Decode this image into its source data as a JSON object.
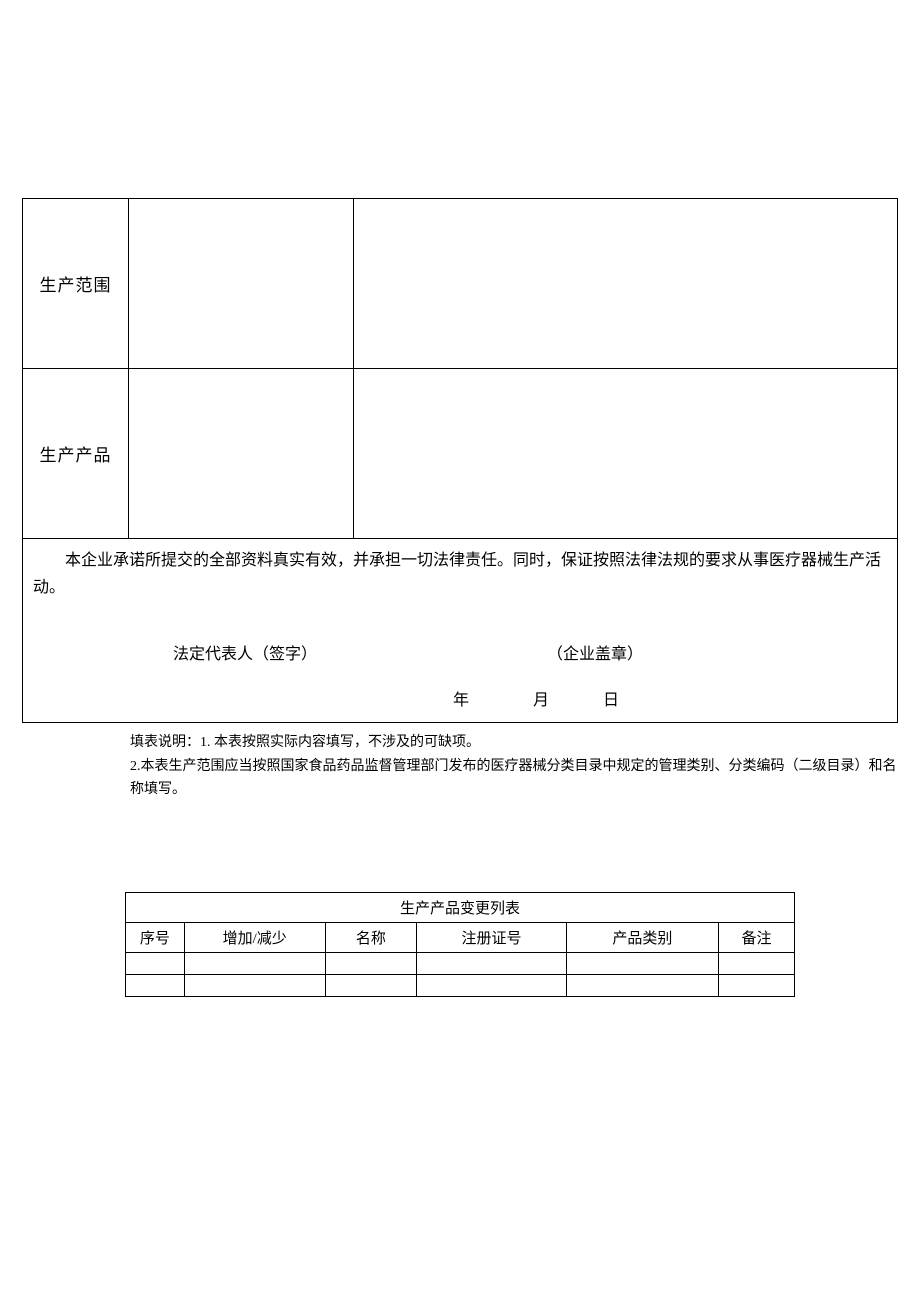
{
  "main": {
    "row1_label": "生产范围",
    "row2_label": "生产产品",
    "declaration": "本企业承诺所提交的全部资料真实有效，并承担一切法律责任。同时，保证按照法律法规的要求从事医疗器械生产活动。",
    "sig_legal_rep": "法定代表人（签字）",
    "sig_seal": "（企业盖章）",
    "date_year": "年",
    "date_month": "月",
    "date_day": "日"
  },
  "notes": {
    "note1": "填表说明：1. 本表按照实际内容填写，不涉及的可缺项。",
    "note2": "2.本表生产范围应当按照国家食品药品监督管理部门发布的医疗器械分类目录中规定的管理类别、分类编码（二级目录）和名称填写。"
  },
  "change_table": {
    "title": "生产产品变更列表",
    "headers": {
      "seq": "序号",
      "inc_dec": "增加/减少",
      "name": "名称",
      "reg_no": "注册证号",
      "category": "产品类别",
      "remark": "备注"
    }
  }
}
